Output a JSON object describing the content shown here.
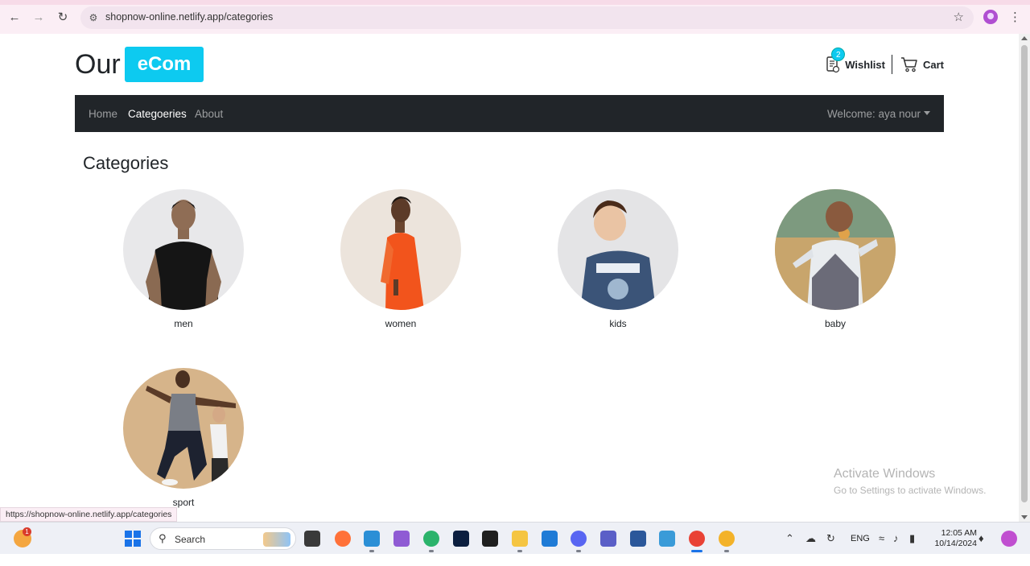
{
  "browser": {
    "url": "shopnow-online.netlify.app/categories",
    "status_url": "https://shopnow-online.netlify.app/categories"
  },
  "header": {
    "logo_text": "Our",
    "logo_badge": "eCom",
    "wishlist_label": "Wishlist",
    "wishlist_count": "2",
    "cart_label": "Cart"
  },
  "navbar": {
    "links": [
      "Home",
      "Categoeries",
      "About"
    ],
    "active": "Categoeries",
    "welcome": "Welcome: aya nour"
  },
  "page": {
    "title": "Categories"
  },
  "categories": [
    {
      "label": "men",
      "bg": "#e8e8ea"
    },
    {
      "label": "women",
      "bg": "#ece4dc"
    },
    {
      "label": "kids",
      "bg": "#e4e4e6"
    },
    {
      "label": "baby",
      "bg": "#b89a66"
    },
    {
      "label": "sport",
      "bg": "#d6b48a"
    }
  ],
  "watermark": {
    "line1": "Activate Windows",
    "line2": "Go to Settings to activate Windows."
  },
  "taskbar": {
    "search_label": "Search",
    "weather_badge": "1",
    "language": "ENG",
    "time": "12:05 AM",
    "date": "10/14/2024"
  },
  "colors": {
    "accent": "#0dcaf0",
    "navbar_bg": "#212529"
  }
}
